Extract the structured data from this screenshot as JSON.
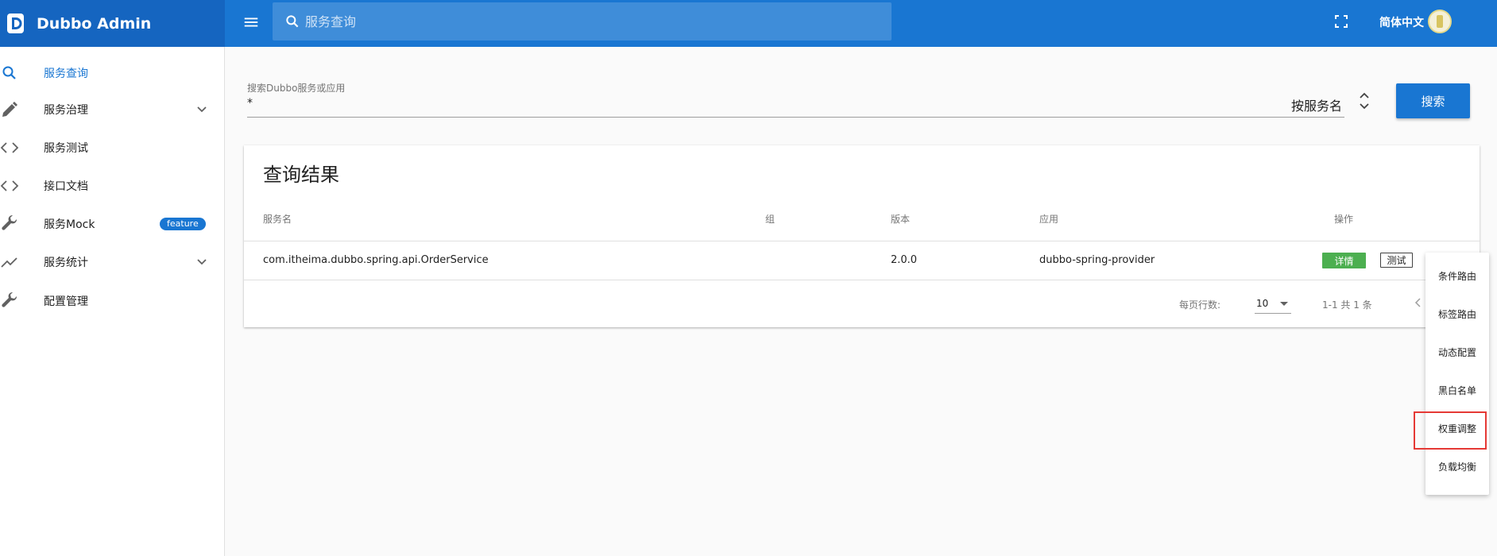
{
  "app": {
    "title": "Dubbo Admin",
    "colors": {
      "brand": "#1565c0",
      "topbar": "#1976d2",
      "accent": "#1976d2",
      "success": "#4caf50",
      "highlight": "#e53935"
    }
  },
  "topbar": {
    "search_placeholder": "服务查询",
    "language": "简体中文",
    "icons": [
      "menu-icon",
      "search-icon",
      "fullscreen-icon",
      "avatar"
    ]
  },
  "sidebar": {
    "items": [
      {
        "label": "服务查询",
        "icon": "search-icon",
        "active": true
      },
      {
        "label": "服务治理",
        "icon": "pencil-icon",
        "expandable": true
      },
      {
        "label": "服务测试",
        "icon": "code-icon"
      },
      {
        "label": "接口文档",
        "icon": "code-icon"
      },
      {
        "label": "服务Mock",
        "icon": "wrench-icon",
        "badge": "feature"
      },
      {
        "label": "服务统计",
        "icon": "trending-icon",
        "expandable": true
      },
      {
        "label": "配置管理",
        "icon": "wrench-icon"
      }
    ]
  },
  "search": {
    "label": "搜索Dubbo服务或应用",
    "value": "*",
    "sort_by": "按服务名",
    "button": "搜索"
  },
  "results": {
    "title": "查询结果",
    "columns": [
      "服务名",
      "组",
      "版本",
      "应用",
      "操作"
    ],
    "rows": [
      {
        "service": "com.itheima.dubbo.spring.api.OrderService",
        "group": "",
        "version": "2.0.0",
        "app": "dubbo-spring-provider",
        "actions": {
          "detail": "详情",
          "test": "测试"
        }
      }
    ],
    "pagination": {
      "rows_per_page_label": "每页行数:",
      "rows_per_page": "10",
      "range": "1-1 共 1 条"
    }
  },
  "dropdown": {
    "items": [
      "条件路由",
      "标签路由",
      "动态配置",
      "黑白名单",
      "权重调整",
      "负载均衡"
    ],
    "highlighted": "权重调整"
  }
}
